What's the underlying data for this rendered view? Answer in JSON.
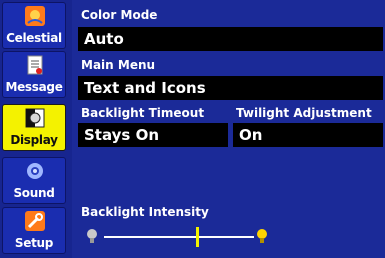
{
  "sidebar": {
    "items": [
      {
        "label": "Celestial",
        "icon": "celestial-icon",
        "active": false
      },
      {
        "label": "Message",
        "icon": "message-icon",
        "active": false
      },
      {
        "label": "Display",
        "icon": "display-icon",
        "active": true
      },
      {
        "label": "Sound",
        "icon": "sound-icon",
        "active": false
      },
      {
        "label": "Setup",
        "icon": "setup-icon",
        "active": false
      }
    ]
  },
  "settings": {
    "color_mode": {
      "label": "Color Mode",
      "value": "Auto"
    },
    "main_menu": {
      "label": "Main Menu",
      "value": "Text and Icons"
    },
    "backlight_timeout": {
      "label": "Backlight Timeout",
      "value": "Stays On"
    },
    "twilight_adjustment": {
      "label": "Twilight Adjustment",
      "value": "On"
    },
    "backlight_intensity": {
      "label": "Backlight Intensity",
      "level_fraction": 0.62
    }
  },
  "colors": {
    "background": "#1b2a98",
    "active_tab": "#f4f200",
    "field_bg": "#000000",
    "text": "#ffffff",
    "accent": "#f4f200"
  }
}
